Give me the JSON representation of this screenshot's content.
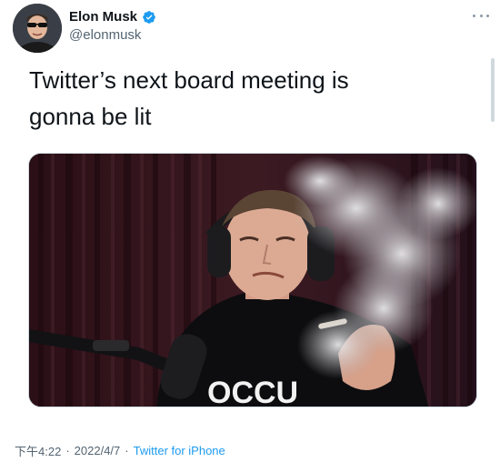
{
  "tweet": {
    "author": {
      "display_name": "Elon Musk",
      "handle": "@elonmusk",
      "verified": true,
      "verified_icon": "verified-badge-icon",
      "avatar_icon": "profile-avatar"
    },
    "text_line1": "Twitter’s next board meeting is",
    "text_line2": "gonna be lit",
    "media": {
      "icon": "photo-smoking-podcast",
      "shirt_text": "OCCU"
    },
    "meta": {
      "time": "下午4:22",
      "separator": "·",
      "date": "2022/4/7",
      "source": "Twitter for iPhone"
    },
    "more_icon": "more-dots-icon"
  },
  "colors": {
    "text_primary": "#0f1419",
    "text_secondary": "#536471",
    "accent": "#1d9bf0",
    "border": "#cfd9de"
  }
}
